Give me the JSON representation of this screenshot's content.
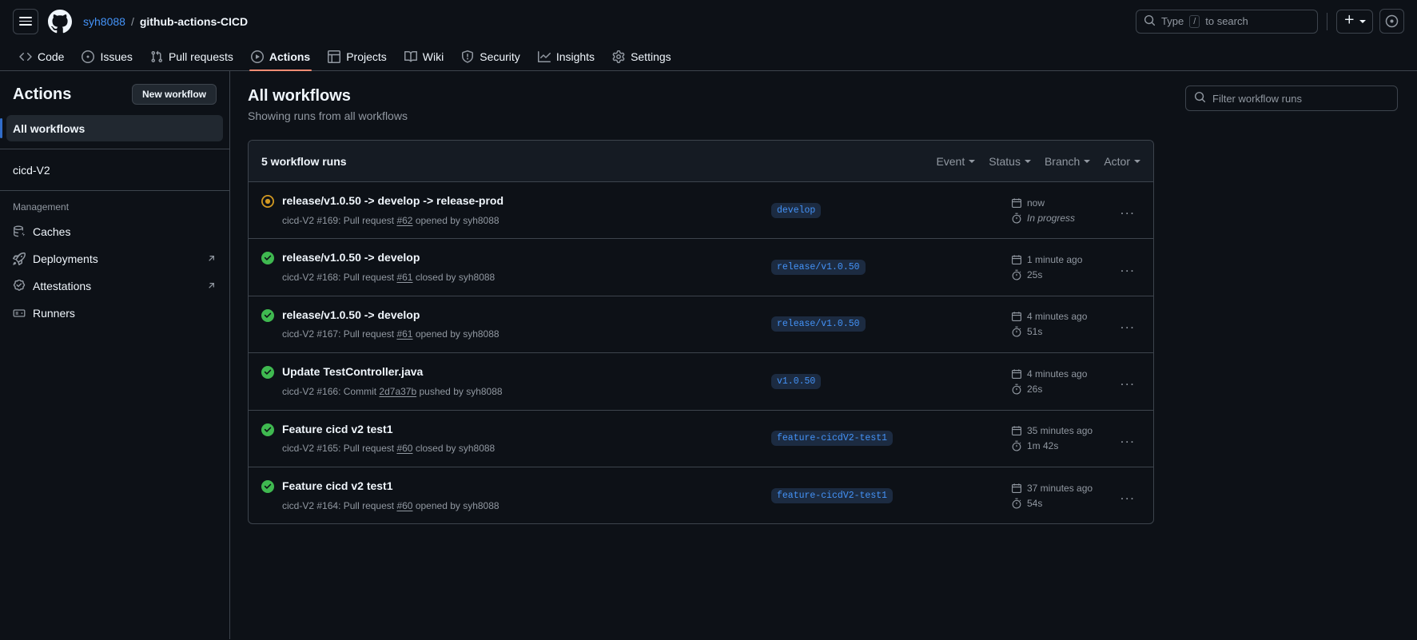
{
  "header": {
    "menu_label": "Open menu",
    "owner": "syh8088",
    "separator": "/",
    "repo": "github-actions-CICD",
    "search_prefix": "Type",
    "search_key": "/",
    "search_suffix": "to search",
    "create_label": "+",
    "profile_label": "Open user menu"
  },
  "repo_nav": [
    {
      "label": "Code",
      "icon": "code-icon",
      "active": false
    },
    {
      "label": "Issues",
      "icon": "issue-opened-icon",
      "active": false
    },
    {
      "label": "Pull requests",
      "icon": "git-pull-request-icon",
      "active": false
    },
    {
      "label": "Actions",
      "icon": "play-icon",
      "active": true
    },
    {
      "label": "Projects",
      "icon": "table-icon",
      "active": false
    },
    {
      "label": "Wiki",
      "icon": "book-icon",
      "active": false
    },
    {
      "label": "Security",
      "icon": "shield-icon",
      "active": false
    },
    {
      "label": "Insights",
      "icon": "graph-icon",
      "active": false
    },
    {
      "label": "Settings",
      "icon": "gear-icon",
      "active": false
    }
  ],
  "sidebar": {
    "title": "Actions",
    "new_workflow_label": "New workflow",
    "all_workflows_label": "All workflows",
    "workflows": [
      {
        "label": "cicd-V2"
      }
    ],
    "management_label": "Management",
    "management_items": [
      {
        "label": "Caches",
        "icon": "cache-icon",
        "external": false
      },
      {
        "label": "Deployments",
        "icon": "rocket-icon",
        "external": true
      },
      {
        "label": "Attestations",
        "icon": "verified-icon",
        "external": true
      },
      {
        "label": "Runners",
        "icon": "server-icon",
        "external": false
      }
    ]
  },
  "main": {
    "title": "All workflows",
    "subtitle": "Showing runs from all workflows",
    "filter_placeholder": "Filter workflow runs",
    "runs_count_label": "5 workflow runs",
    "filters": [
      {
        "label": "Event"
      },
      {
        "label": "Status"
      },
      {
        "label": "Branch"
      },
      {
        "label": "Actor"
      }
    ],
    "runs": [
      {
        "status": "in-progress",
        "name": "release/v1.0.50 -> develop -> release-prod",
        "workflow": "cicd-V2",
        "run_number": "#169",
        "event_prefix": "Pull request",
        "event_ref": "#62",
        "event_suffix": "opened by syh8088",
        "branch": "develop",
        "time": "now",
        "duration": "In progress",
        "duration_italic": true
      },
      {
        "status": "success",
        "name": "release/v1.0.50 -> develop",
        "workflow": "cicd-V2",
        "run_number": "#168",
        "event_prefix": "Pull request",
        "event_ref": "#61",
        "event_suffix": "closed by syh8088",
        "branch": "release/v1.0.50",
        "time": "1 minute ago",
        "duration": "25s",
        "duration_italic": false
      },
      {
        "status": "success",
        "name": "release/v1.0.50 -> develop",
        "workflow": "cicd-V2",
        "run_number": "#167",
        "event_prefix": "Pull request",
        "event_ref": "#61",
        "event_suffix": "opened by syh8088",
        "branch": "release/v1.0.50",
        "time": "4 minutes ago",
        "duration": "51s",
        "duration_italic": false
      },
      {
        "status": "success",
        "name": "Update TestController.java",
        "workflow": "cicd-V2",
        "run_number": "#166",
        "event_prefix": "Commit",
        "event_ref": "2d7a37b",
        "event_suffix": "pushed by syh8088",
        "branch": "v1.0.50",
        "time": "4 minutes ago",
        "duration": "26s",
        "duration_italic": false
      },
      {
        "status": "success",
        "name": "Feature cicd v2 test1",
        "workflow": "cicd-V2",
        "run_number": "#165",
        "event_prefix": "Pull request",
        "event_ref": "#60",
        "event_suffix": "closed by syh8088",
        "branch": "feature-cicdV2-test1",
        "time": "35 minutes ago",
        "duration": "1m 42s",
        "duration_italic": false
      },
      {
        "status": "success",
        "name": "Feature cicd v2 test1",
        "workflow": "cicd-V2",
        "run_number": "#164",
        "event_prefix": "Pull request",
        "event_ref": "#60",
        "event_suffix": "opened by syh8088",
        "branch": "feature-cicdV2-test1",
        "time": "37 minutes ago",
        "duration": "54s",
        "duration_italic": false
      }
    ],
    "kebab_label": "..."
  },
  "colors": {
    "background": "#0d1117",
    "surface": "#151b23",
    "border": "#3d444d",
    "link": "#4493f8",
    "success": "#3fb950",
    "in_progress": "#d29922",
    "active_tab": "#fd8c73",
    "selected_bar": "#316dca",
    "muted_text": "#9198a1"
  }
}
